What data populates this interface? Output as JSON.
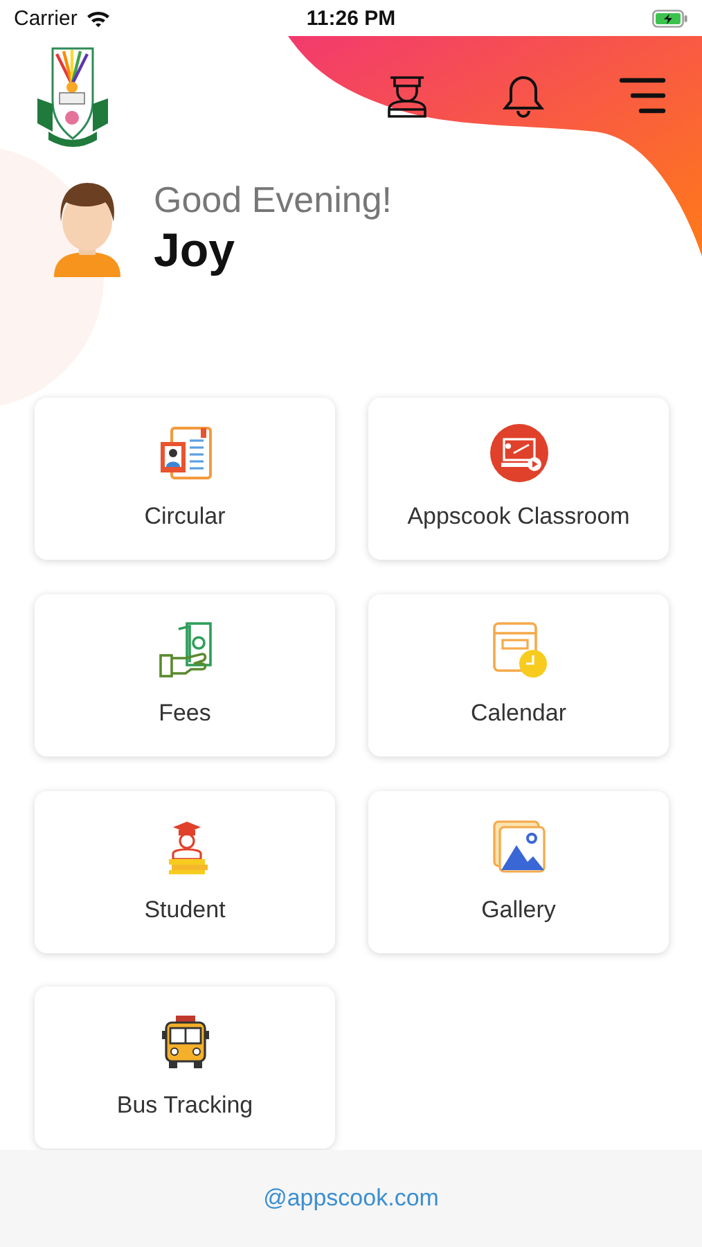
{
  "status_bar": {
    "carrier": "Carrier",
    "time": "11:26 PM"
  },
  "greeting": {
    "salutation": "Good Evening!",
    "name": "Joy"
  },
  "tiles": [
    {
      "label": "Circular",
      "kind": "circular"
    },
    {
      "label": "Appscook Classroom",
      "kind": "classroom"
    },
    {
      "label": "Fees",
      "kind": "fees"
    },
    {
      "label": "Calendar",
      "kind": "calendar"
    },
    {
      "label": "Student",
      "kind": "student"
    },
    {
      "label": "Gallery",
      "kind": "gallery"
    },
    {
      "label": "Bus Tracking",
      "kind": "bus"
    }
  ],
  "footer": {
    "link": "@appscook.com"
  }
}
